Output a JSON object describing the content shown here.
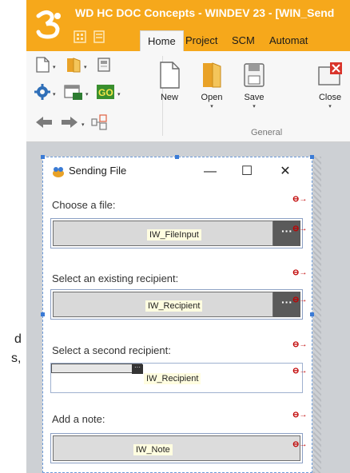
{
  "titlebar": {
    "title": "WD HC DOC Concepts - WINDEV 23 - [WIN_Send",
    "tabs": [
      {
        "label": "Home",
        "active": true
      },
      {
        "label": "Project",
        "active": false
      },
      {
        "label": "SCM",
        "active": false
      },
      {
        "label": "Automat",
        "active": false
      }
    ]
  },
  "ribbon": {
    "buttons": [
      {
        "label": "New",
        "icon": "new-document-icon"
      },
      {
        "label": "Open",
        "icon": "open-folder-icon"
      },
      {
        "label": "Save",
        "icon": "save-icon"
      },
      {
        "label": "Close",
        "icon": "close-window-icon"
      }
    ],
    "group_label": "General",
    "small_icon_rows": [
      [
        "new-small-icon",
        "door-icon",
        "window-icon"
      ],
      [
        "gear-icon",
        "form-icon",
        "go-icon"
      ],
      [
        "back-arrow-icon",
        "forward-arrow-icon",
        "layout-icon"
      ]
    ],
    "dropdown_glyph": "▾"
  },
  "left_strip": {
    "fragment_1": "d",
    "fragment_2": "s,"
  },
  "window": {
    "title": "Sending File",
    "minimize_glyph": "—",
    "maximize_glyph": "☐",
    "close_glyph": "✕",
    "link_glyph": "⊖→"
  },
  "form": {
    "file_label": "Choose a file:",
    "file_control": "IW_FileInput",
    "recipient_label": "Select an existing recipient:",
    "recipient_control": "IW_Recipient",
    "second_label": "Select a second recipient:",
    "second_control": "IW_Recipient",
    "note_label": "Add a note:",
    "note_control": "IW_Note",
    "dots_label": "···"
  },
  "colors": {
    "title_bar": "#f6a81b",
    "ribbon": "#f7f7f7",
    "editor": "#cdd0d4",
    "link_arrow": "#c00000",
    "selection": "#3b7bd6"
  }
}
